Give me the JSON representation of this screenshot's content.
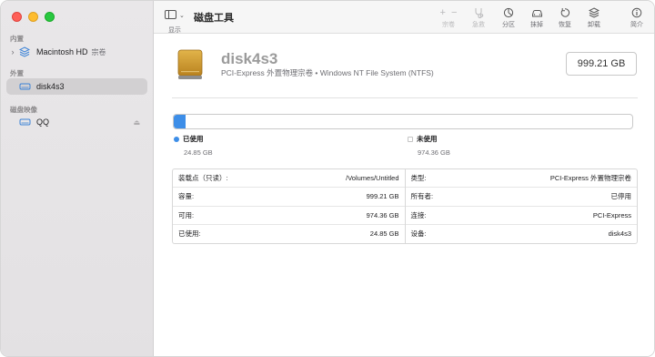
{
  "toolbar": {
    "view_label": "显示",
    "title": "磁盘工具",
    "buttons": [
      {
        "label": "宗卷",
        "icon": "plus-minus-icon",
        "disabled": true
      },
      {
        "label": "急救",
        "icon": "stethoscope-icon",
        "disabled": true
      },
      {
        "label": "分区",
        "icon": "pie-chart-icon",
        "disabled": false
      },
      {
        "label": "抹掉",
        "icon": "erase-car-icon",
        "disabled": false
      },
      {
        "label": "恢复",
        "icon": "restore-icon",
        "disabled": false
      },
      {
        "label": "卸载",
        "icon": "unmount-icon",
        "disabled": false
      },
      {
        "label": "简介",
        "icon": "info-icon",
        "disabled": false
      }
    ]
  },
  "sidebar": {
    "internal_header": "内置",
    "external_header": "外置",
    "images_header": "磁盘映像",
    "items": [
      {
        "label": "Macintosh HD",
        "sub": "宗卷"
      },
      {
        "label": "disk4s3"
      },
      {
        "label": "QQ"
      }
    ]
  },
  "disk": {
    "name": "disk4s3",
    "description": "PCI-Express 外置物理宗卷 • Windows NT File System (NTFS)",
    "capacity": "999.21 GB"
  },
  "usage": {
    "used_fraction": 0.0249,
    "used_label": "已使用",
    "used_value": "24.85 GB",
    "free_label": "未使用",
    "free_value": "974.36 GB",
    "used_color": "#3d8ee8"
  },
  "info": {
    "left": [
      {
        "key": "装载点（只读）:",
        "value": "/Volumes/Untitled"
      },
      {
        "key": "容量:",
        "value": "999.21 GB"
      },
      {
        "key": "可用:",
        "value": "974.36 GB"
      },
      {
        "key": "已使用:",
        "value": "24.85 GB"
      }
    ],
    "right": [
      {
        "key": "类型:",
        "value": "PCI-Express 外置物理宗卷"
      },
      {
        "key": "所有者:",
        "value": "已停用"
      },
      {
        "key": "连接:",
        "value": "PCI-Express"
      },
      {
        "key": "设备:",
        "value": "disk4s3"
      }
    ]
  }
}
